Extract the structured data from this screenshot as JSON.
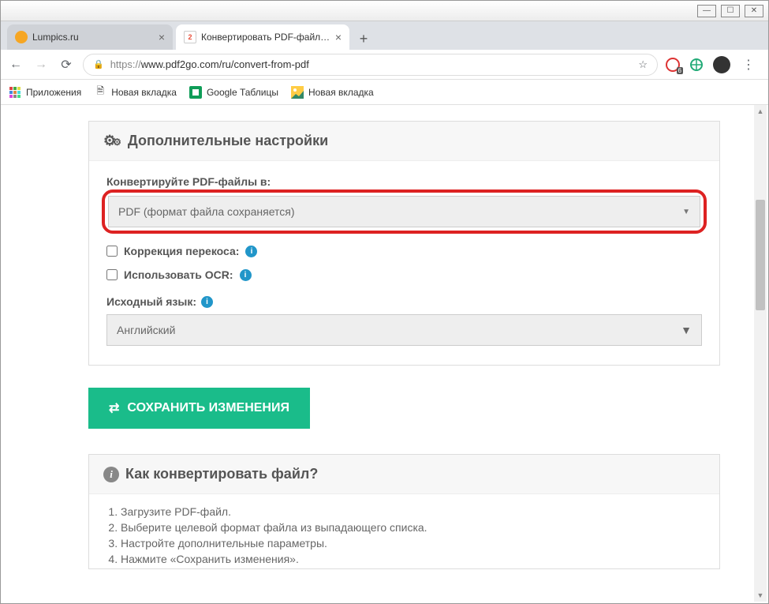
{
  "window": {
    "tabs": [
      {
        "title": "Lumpics.ru",
        "favColor": "#f6a623"
      },
      {
        "title": "Конвертировать PDF-файл — К",
        "favColor": "#e94e3a"
      }
    ],
    "url": "https://www.pdf2go.com/ru/convert-from-pdf",
    "urlProto": "https://",
    "urlRest": "www.pdf2go.com/ru/convert-from-pdf"
  },
  "bookmarks": {
    "apps": "Приложения",
    "items": [
      {
        "label": "Новая вкладка",
        "icon": "doc"
      },
      {
        "label": "Google Таблицы",
        "icon": "sheets"
      },
      {
        "label": "Новая вкладка",
        "icon": "img"
      }
    ]
  },
  "page": {
    "settings_title": "Дополнительные настройки",
    "convert_label": "Конвертируйте PDF-файлы в:",
    "format_select": "PDF (формат файла сохраняется)",
    "deskew_label": "Коррекция перекоса:",
    "ocr_label": "Использовать OCR:",
    "source_lang_label": "Исходный язык:",
    "lang_select": "Английский",
    "save_btn": "СОХРАНИТЬ ИЗМЕНЕНИЯ",
    "how_title": "Как конвертировать файл?",
    "how_steps": [
      "Загрузите PDF-файл.",
      "Выберите целевой формат файла из выпадающего списка.",
      "Настройте дополнительные параметры.",
      "Нажмите «Сохранить изменения»."
    ]
  }
}
